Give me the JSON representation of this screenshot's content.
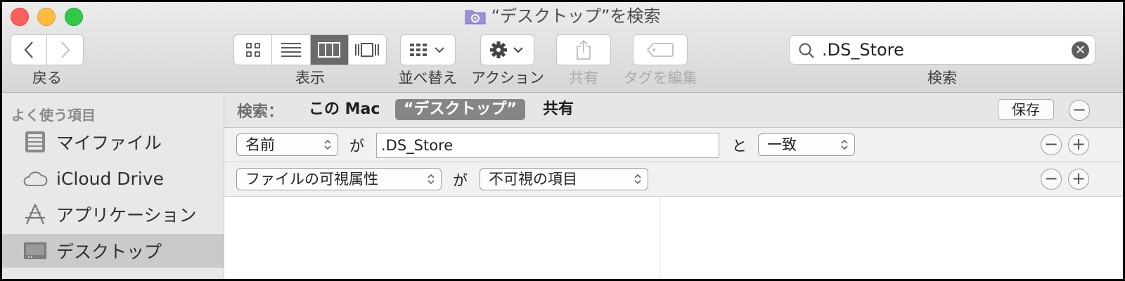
{
  "window": {
    "title": "“デスクトップ”を検索",
    "icons": {
      "folder": "folder-icon"
    }
  },
  "toolbar": {
    "back_label": "戻る",
    "view_label": "表示",
    "arrange_label": "並べ替え",
    "action_label": "アクション",
    "share_label": "共有",
    "tags_label": "タグを編集",
    "search_label": "検索",
    "search_value": ".DS_Store",
    "view_modes": [
      "icon",
      "list",
      "column",
      "coverflow"
    ],
    "active_view": "column"
  },
  "sidebar": {
    "heading": "よく使う項目",
    "items": [
      {
        "label": "マイファイル",
        "icon": "all-files-icon"
      },
      {
        "label": "iCloud Drive",
        "icon": "cloud-icon"
      },
      {
        "label": "アプリケーション",
        "icon": "applications-icon"
      },
      {
        "label": "デスクトップ",
        "icon": "desktop-icon",
        "selected": true
      }
    ]
  },
  "scope": {
    "label": "検索：",
    "options": [
      "この Mac",
      "“デスクトップ”",
      "共有"
    ],
    "active_index": 1,
    "save_label": "保存",
    "remove_symbol": "−"
  },
  "rules": [
    {
      "attribute": "名前",
      "connector": "が",
      "value": ".DS_Store",
      "connector2": "と",
      "operator": "一致"
    },
    {
      "attribute": "ファイルの可視属性",
      "connector": "が",
      "operator": "不可視の項目"
    }
  ],
  "rule_buttons": {
    "minus": "−",
    "plus": "+"
  },
  "colors": {
    "close": "#fc605c",
    "minimize": "#fdbc40",
    "zoom": "#34c84a",
    "selected_scope": "#868686",
    "sidebar_selection": "#cacacc"
  }
}
